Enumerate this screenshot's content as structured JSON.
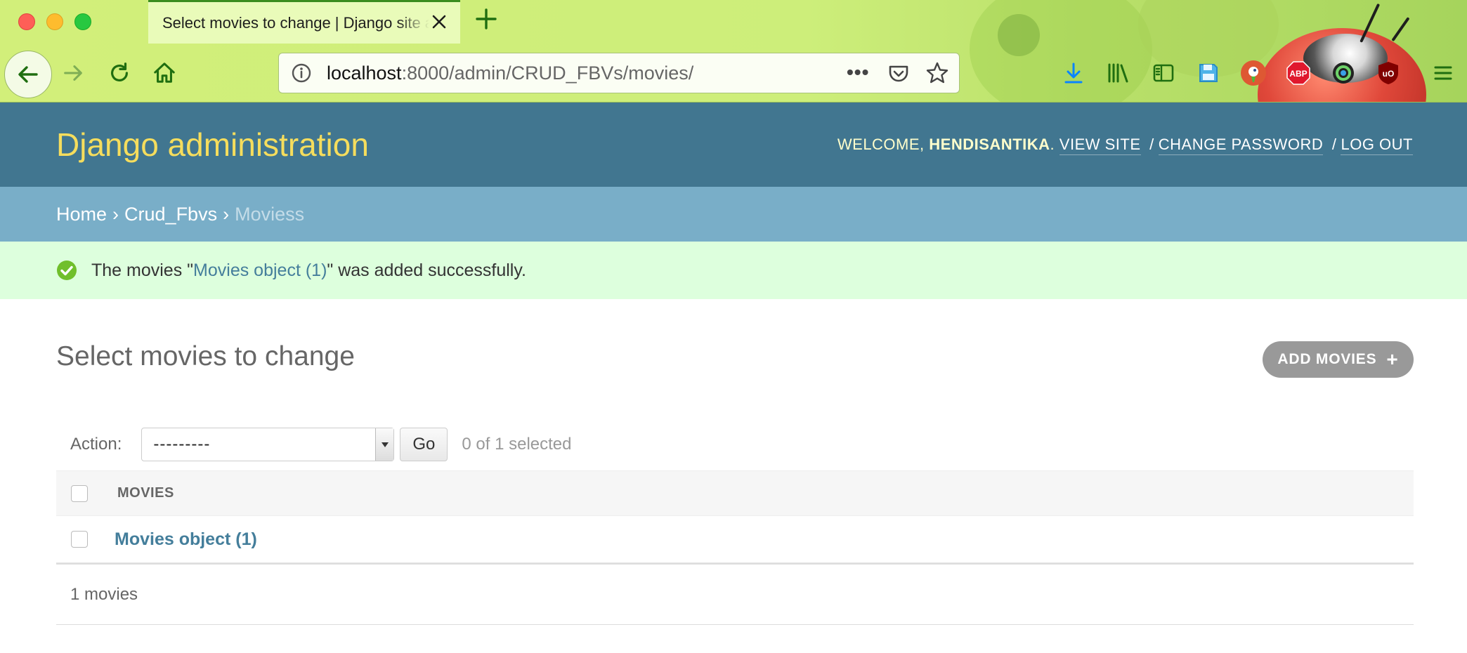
{
  "browser": {
    "tab_title": "Select movies to change | Django site admin",
    "url_host": "localhost",
    "url_rest": ":8000/admin/CRUD_FBVs/movies/",
    "more_label": "•••",
    "ext_abp": "ABP",
    "ext_ublock": "uO"
  },
  "admin": {
    "branding": "Django administration",
    "user_tools": {
      "welcome": "WELCOME,",
      "username": "HENDISANTIKA",
      "username_suffix": ".",
      "view_site": "VIEW SITE",
      "change_password": "CHANGE PASSWORD",
      "log_out": "LOG OUT",
      "separator": "/"
    },
    "breadcrumbs": {
      "home": "Home",
      "app": "Crud_Fbvs",
      "current": "Moviess",
      "separator": "›"
    },
    "message": {
      "prefix": "The movies \"",
      "link": "Movies object (1)",
      "suffix": "\" was added successfully."
    },
    "title": "Select movies to change",
    "add_button": "ADD MOVIES",
    "add_icon": "+",
    "actions": {
      "label": "Action:",
      "selected": "---------",
      "go": "Go",
      "counter": "0 of 1 selected"
    },
    "table": {
      "column_header": "MOVIES",
      "rows": [
        {
          "label": "Movies object (1)",
          "checked": false
        }
      ]
    },
    "paginator": "1 movies"
  }
}
